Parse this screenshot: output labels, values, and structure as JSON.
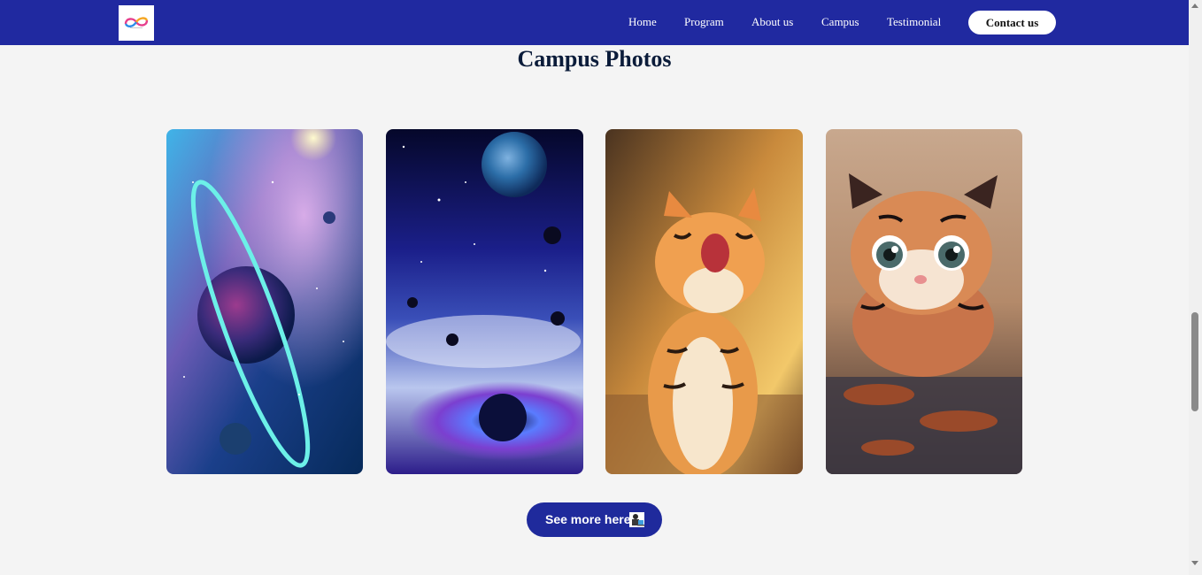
{
  "nav": {
    "logo_icon": "infinity-logo",
    "links": [
      "Home",
      "Program",
      "About us",
      "Campus",
      "Testimonial"
    ],
    "contact_label": "Contact us",
    "bar_color": "#2029a0"
  },
  "section": {
    "title": "Campus Photos"
  },
  "photos": [
    {
      "subject": "ringed-planet-nebula"
    },
    {
      "subject": "earth-and-galaxy-space"
    },
    {
      "subject": "yawning-tiger-cub"
    },
    {
      "subject": "tiger-cub-in-water"
    }
  ],
  "see_more": {
    "label": "See more here",
    "icon": "person-at-computer-icon",
    "color": "#1f2a9c"
  }
}
